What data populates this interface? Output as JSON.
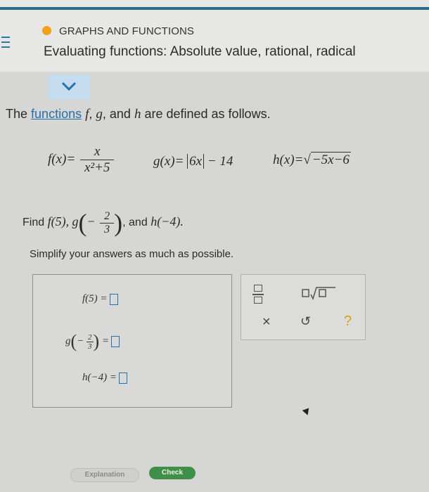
{
  "header": {
    "topic": "GRAPHS AND FUNCTIONS",
    "subtitle": "Evaluating functions: Absolute value, rational, radical",
    "topic_dot_color": "#f2a11c"
  },
  "problem": {
    "intro_prefix": "The",
    "intro_link": "functions",
    "intro_suffix": "are defined as follows.",
    "f_label": "f(x)=",
    "f_num": "x",
    "f_den": "x²+5",
    "g_def": "g(x)=",
    "g_abs": "6x",
    "g_rest": "− 14",
    "h_def": "h(x)=",
    "h_rad": "−5x−6",
    "find_prefix": "Find",
    "find_f": "f(5),",
    "find_g": "g",
    "find_g_sign": "−",
    "find_g_num": "2",
    "find_g_den": "3",
    "find_and": ", and",
    "find_h": "h(−4).",
    "simplify": "Simplify your answers as much as possible."
  },
  "answers": {
    "f_label": "f(5) =",
    "g_label_pre": "g",
    "g_sign": "−",
    "g_num": "2",
    "g_den": "3",
    "g_label_post": "=",
    "h_label": "h(−4) ="
  },
  "keypad": {
    "times": "×",
    "undo": "↺",
    "help": "?"
  },
  "buttons": {
    "explanation": "Explanation",
    "check": "Check"
  },
  "colors": {
    "accent": "#2a6fa8",
    "check": "#3f8f49"
  }
}
